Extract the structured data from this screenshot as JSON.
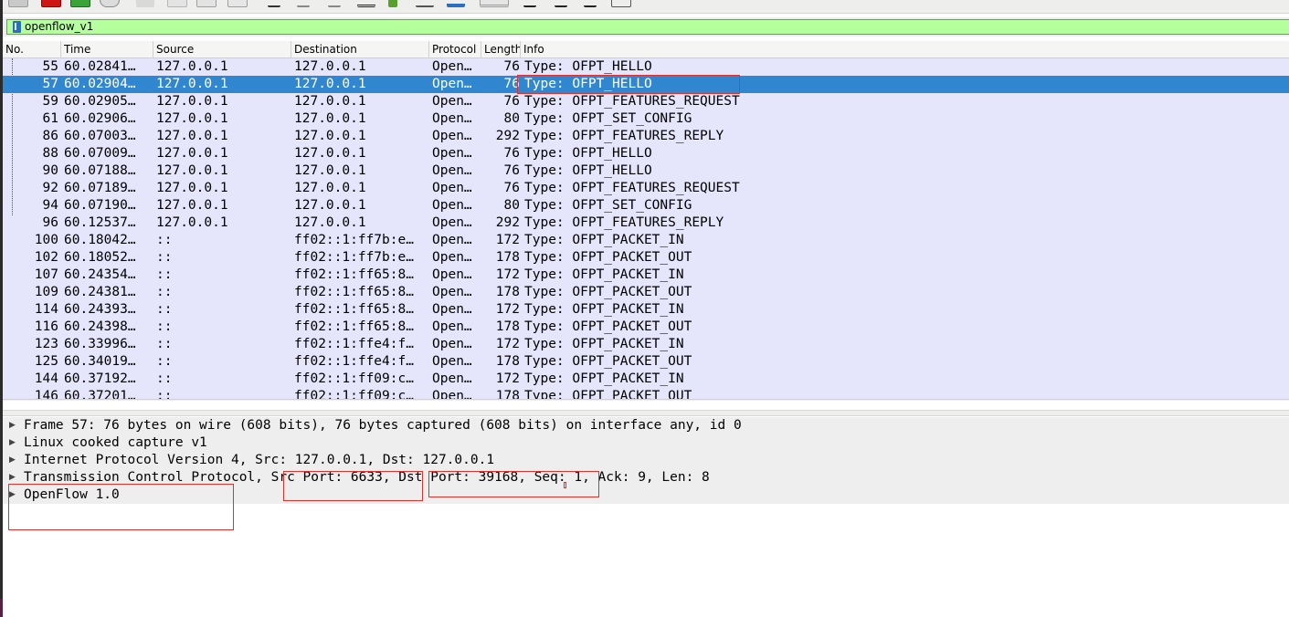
{
  "toolbar": {
    "buttons": [
      {
        "name": "start-capture-icon"
      },
      {
        "name": "stop-capture-icon"
      },
      {
        "name": "restart-capture-icon"
      },
      {
        "name": "capture-options-icon"
      },
      {
        "name": "open-file-icon"
      },
      {
        "name": "save-file-icon"
      },
      {
        "name": "close-file-icon"
      },
      {
        "name": "reload-icon"
      },
      {
        "name": "find-packet-icon"
      },
      {
        "name": "go-back-icon"
      },
      {
        "name": "go-forward-icon"
      },
      {
        "name": "go-to-packet-icon"
      },
      {
        "name": "first-packet-icon"
      },
      {
        "name": "last-packet-icon"
      },
      {
        "name": "autoscroll-icon"
      },
      {
        "name": "colorize-icon"
      },
      {
        "name": "zoom-in-icon"
      },
      {
        "name": "zoom-out-icon"
      },
      {
        "name": "normal-size-icon"
      },
      {
        "name": "resize-columns-icon"
      }
    ]
  },
  "filter": {
    "value": "openflow_v1"
  },
  "packet_list": {
    "columns": [
      "No.",
      "Time",
      "Source",
      "Destination",
      "Protocol",
      "Length",
      "Info"
    ],
    "selected_row": 1,
    "rows": [
      {
        "no": "55",
        "time": "60.02841…",
        "src": "127.0.0.1",
        "dst": "127.0.0.1",
        "proto": "Open…",
        "len": "76",
        "info": "Type: OFPT_HELLO"
      },
      {
        "no": "57",
        "time": "60.02904…",
        "src": "127.0.0.1",
        "dst": "127.0.0.1",
        "proto": "Open…",
        "len": "76",
        "info": "Type: OFPT_HELLO"
      },
      {
        "no": "59",
        "time": "60.02905…",
        "src": "127.0.0.1",
        "dst": "127.0.0.1",
        "proto": "Open…",
        "len": "76",
        "info": "Type: OFPT_FEATURES_REQUEST"
      },
      {
        "no": "61",
        "time": "60.02906…",
        "src": "127.0.0.1",
        "dst": "127.0.0.1",
        "proto": "Open…",
        "len": "80",
        "info": "Type: OFPT_SET_CONFIG"
      },
      {
        "no": "86",
        "time": "60.07003…",
        "src": "127.0.0.1",
        "dst": "127.0.0.1",
        "proto": "Open…",
        "len": "292",
        "info": "Type: OFPT_FEATURES_REPLY"
      },
      {
        "no": "88",
        "time": "60.07009…",
        "src": "127.0.0.1",
        "dst": "127.0.0.1",
        "proto": "Open…",
        "len": "76",
        "info": "Type: OFPT_HELLO"
      },
      {
        "no": "90",
        "time": "60.07188…",
        "src": "127.0.0.1",
        "dst": "127.0.0.1",
        "proto": "Open…",
        "len": "76",
        "info": "Type: OFPT_HELLO"
      },
      {
        "no": "92",
        "time": "60.07189…",
        "src": "127.0.0.1",
        "dst": "127.0.0.1",
        "proto": "Open…",
        "len": "76",
        "info": "Type: OFPT_FEATURES_REQUEST"
      },
      {
        "no": "94",
        "time": "60.07190…",
        "src": "127.0.0.1",
        "dst": "127.0.0.1",
        "proto": "Open…",
        "len": "80",
        "info": "Type: OFPT_SET_CONFIG"
      },
      {
        "no": "96",
        "time": "60.12537…",
        "src": "127.0.0.1",
        "dst": "127.0.0.1",
        "proto": "Open…",
        "len": "292",
        "info": "Type: OFPT_FEATURES_REPLY"
      },
      {
        "no": "100",
        "time": "60.18042…",
        "src": "::",
        "dst": "ff02::1:ff7b:e…",
        "proto": "Open…",
        "len": "172",
        "info": "Type: OFPT_PACKET_IN"
      },
      {
        "no": "102",
        "time": "60.18052…",
        "src": "::",
        "dst": "ff02::1:ff7b:e…",
        "proto": "Open…",
        "len": "178",
        "info": "Type: OFPT_PACKET_OUT"
      },
      {
        "no": "107",
        "time": "60.24354…",
        "src": "::",
        "dst": "ff02::1:ff65:8…",
        "proto": "Open…",
        "len": "172",
        "info": "Type: OFPT_PACKET_IN"
      },
      {
        "no": "109",
        "time": "60.24381…",
        "src": "::",
        "dst": "ff02::1:ff65:8…",
        "proto": "Open…",
        "len": "178",
        "info": "Type: OFPT_PACKET_OUT"
      },
      {
        "no": "114",
        "time": "60.24393…",
        "src": "::",
        "dst": "ff02::1:ff65:8…",
        "proto": "Open…",
        "len": "172",
        "info": "Type: OFPT_PACKET_IN"
      },
      {
        "no": "116",
        "time": "60.24398…",
        "src": "::",
        "dst": "ff02::1:ff65:8…",
        "proto": "Open…",
        "len": "178",
        "info": "Type: OFPT_PACKET_OUT"
      },
      {
        "no": "123",
        "time": "60.33996…",
        "src": "::",
        "dst": "ff02::1:ffe4:f…",
        "proto": "Open…",
        "len": "172",
        "info": "Type: OFPT_PACKET_IN"
      },
      {
        "no": "125",
        "time": "60.34019…",
        "src": "::",
        "dst": "ff02::1:ffe4:f…",
        "proto": "Open…",
        "len": "178",
        "info": "Type: OFPT_PACKET_OUT"
      },
      {
        "no": "144",
        "time": "60.37192…",
        "src": "::",
        "dst": "ff02::1:ff09:c…",
        "proto": "Open…",
        "len": "172",
        "info": "Type: OFPT_PACKET_IN"
      },
      {
        "no": "146",
        "time": "60.37201…",
        "src": "::",
        "dst": "ff02::1:ff09:c…",
        "proto": "Open…",
        "len": "178",
        "info": "Type: OFPT_PACKET_OUT"
      }
    ]
  },
  "details": {
    "items": [
      {
        "text": "Frame 57: 76 bytes on wire (608 bits), 76 bytes captured (608 bits) on interface any, id 0"
      },
      {
        "text": "Linux cooked capture v1"
      },
      {
        "text": "Internet Protocol Version 4, Src: 127.0.0.1, Dst: 127.0.0.1"
      },
      {
        "text": "Transmission Control Protocol, Src Port: 6633, Dst Port: 39168, Seq: 1, Ack: 9, Len: 8"
      },
      {
        "text": "OpenFlow 1.0"
      }
    ]
  },
  "colors": {
    "filter_ok_bg": "#b6ff9e",
    "row_bg": "#e5e5fb",
    "selected_bg": "#3087cf",
    "annotation": "#e0322c"
  }
}
